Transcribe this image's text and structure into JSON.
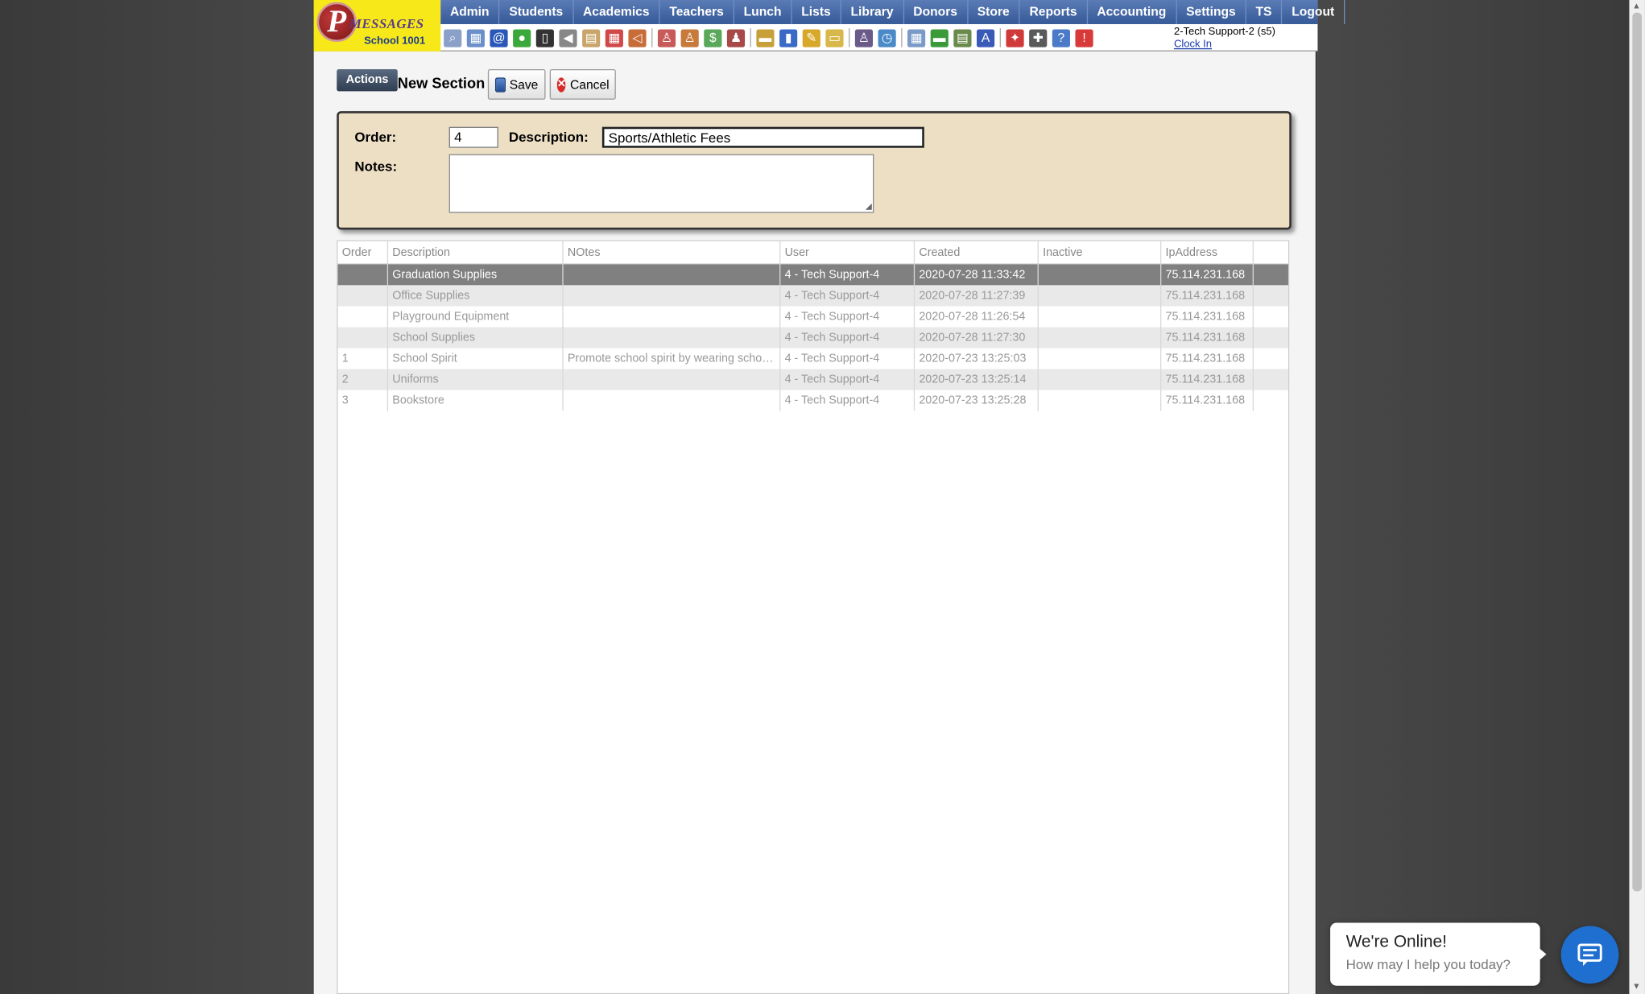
{
  "logo": {
    "letter": "P",
    "messages": "MESSAGES",
    "school": "School 1001"
  },
  "menu": [
    "Admin",
    "Students",
    "Academics",
    "Teachers",
    "Lunch",
    "Lists",
    "Library",
    "Donors",
    "Store",
    "Reports",
    "Accounting",
    "Settings",
    "TS",
    "Logout"
  ],
  "user": {
    "name": "2-Tech Support-2 (s5)",
    "clock_in": "Clock In"
  },
  "actions": {
    "tab": "Actions",
    "title": "New Section",
    "save": "Save",
    "cancel": "Cancel",
    "cancel_glyph": "✕"
  },
  "form": {
    "order_label": "Order:",
    "order_value": "4",
    "description_label": "Description:",
    "description_value": "Sports/Athletic Fees",
    "notes_label": "Notes:",
    "notes_value": ""
  },
  "table": {
    "headers": [
      "Order",
      "Description",
      "NOtes",
      "User",
      "Created",
      "Inactive",
      "IpAddress"
    ],
    "rows": [
      {
        "order": "",
        "description": "Graduation Supplies",
        "notes": "",
        "user": "4 - Tech Support-4",
        "created": "2020-07-28 11:33:42",
        "inactive": "",
        "ip": "75.114.231.168"
      },
      {
        "order": "",
        "description": "Office Supplies",
        "notes": "",
        "user": "4 - Tech Support-4",
        "created": "2020-07-28 11:27:39",
        "inactive": "",
        "ip": "75.114.231.168"
      },
      {
        "order": "",
        "description": "Playground Equipment",
        "notes": "",
        "user": "4 - Tech Support-4",
        "created": "2020-07-28 11:26:54",
        "inactive": "",
        "ip": "75.114.231.168"
      },
      {
        "order": "",
        "description": "School Supplies",
        "notes": "",
        "user": "4 - Tech Support-4",
        "created": "2020-07-28 11:27:30",
        "inactive": "",
        "ip": "75.114.231.168"
      },
      {
        "order": "1",
        "description": "School Spirit",
        "notes": "Promote school spirit by wearing schoo...",
        "user": "4 - Tech Support-4",
        "created": "2020-07-23 13:25:03",
        "inactive": "",
        "ip": "75.114.231.168"
      },
      {
        "order": "2",
        "description": "Uniforms",
        "notes": "",
        "user": "4 - Tech Support-4",
        "created": "2020-07-23 13:25:14",
        "inactive": "",
        "ip": "75.114.231.168"
      },
      {
        "order": "3",
        "description": "Bookstore",
        "notes": "",
        "user": "4 - Tech Support-4",
        "created": "2020-07-23 13:25:28",
        "inactive": "",
        "ip": "75.114.231.168"
      }
    ]
  },
  "toolbar_icons": [
    {
      "name": "search-icon",
      "color": "#8aa0c8",
      "glyph": "⌕"
    },
    {
      "name": "grid-icon",
      "color": "#6b8fc9",
      "glyph": "▦"
    },
    {
      "name": "email-icon",
      "color": "#2a58b8",
      "glyph": "@"
    },
    {
      "name": "chat-icon",
      "color": "#3aa83a",
      "glyph": "●"
    },
    {
      "name": "phone-icon",
      "color": "#333333",
      "glyph": "▯"
    },
    {
      "name": "speaker-icon",
      "color": "#888888",
      "glyph": "◀"
    },
    {
      "name": "document-icon",
      "color": "#c9a46b",
      "glyph": "▤"
    },
    {
      "name": "calendar-icon",
      "color": "#d04848",
      "glyph": "▦"
    },
    {
      "name": "megaphone-icon",
      "color": "#c86d3a",
      "glyph": "◁"
    },
    {
      "name": "sep",
      "color": "",
      "glyph": ""
    },
    {
      "name": "student-icon",
      "color": "#c85a5a",
      "glyph": "♙"
    },
    {
      "name": "teacher-icon",
      "color": "#c87a3a",
      "glyph": "♙"
    },
    {
      "name": "money-icon",
      "color": "#5aa85a",
      "glyph": "$"
    },
    {
      "name": "group-icon",
      "color": "#a84848",
      "glyph": "♟"
    },
    {
      "name": "sep",
      "color": "",
      "glyph": ""
    },
    {
      "name": "lunch-icon",
      "color": "#c8a03a",
      "glyph": "▬"
    },
    {
      "name": "book-icon",
      "color": "#3a6ac8",
      "glyph": "▮"
    },
    {
      "name": "pencil-icon",
      "color": "#d8a82a",
      "glyph": "✎"
    },
    {
      "name": "folder-icon",
      "color": "#d8b84a",
      "glyph": "▭"
    },
    {
      "name": "sep",
      "color": "",
      "glyph": ""
    },
    {
      "name": "person-icon",
      "color": "#6a5a8a",
      "glyph": "♙"
    },
    {
      "name": "clock-icon",
      "color": "#4a8ac8",
      "glyph": "◷"
    },
    {
      "name": "sep",
      "color": "",
      "glyph": ""
    },
    {
      "name": "table-icon",
      "color": "#7a9ac8",
      "glyph": "▦"
    },
    {
      "name": "card-icon",
      "color": "#3a9a3a",
      "glyph": "▬"
    },
    {
      "name": "printer-icon",
      "color": "#6a8a4a",
      "glyph": "▤"
    },
    {
      "name": "ap-icon",
      "color": "#3a5ab8",
      "glyph": "A"
    },
    {
      "name": "sep",
      "color": "",
      "glyph": ""
    },
    {
      "name": "pdf-icon",
      "color": "#d03a3a",
      "glyph": "✦"
    },
    {
      "name": "tools-icon",
      "color": "#5a5a5a",
      "glyph": "✚"
    },
    {
      "name": "help-icon",
      "color": "#4a7ac8",
      "glyph": "?"
    },
    {
      "name": "power-icon",
      "color": "#d83a3a",
      "glyph": "!"
    }
  ],
  "chat": {
    "title": "We're Online!",
    "subtitle": "How may I help you today?"
  }
}
